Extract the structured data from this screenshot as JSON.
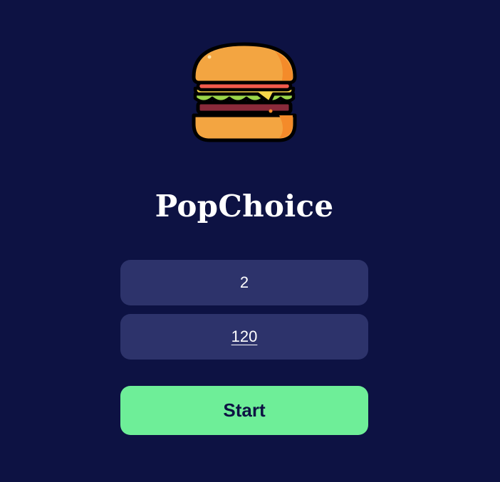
{
  "app": {
    "title": "PopChoice",
    "logo_icon": "burger-icon"
  },
  "form": {
    "field_one_value": "2",
    "field_two_value": "120",
    "start_label": "Start"
  },
  "colors": {
    "background": "#0d1243",
    "field_background": "#2d336b",
    "button_accent": "#6eee98",
    "text": "#ffffff"
  }
}
